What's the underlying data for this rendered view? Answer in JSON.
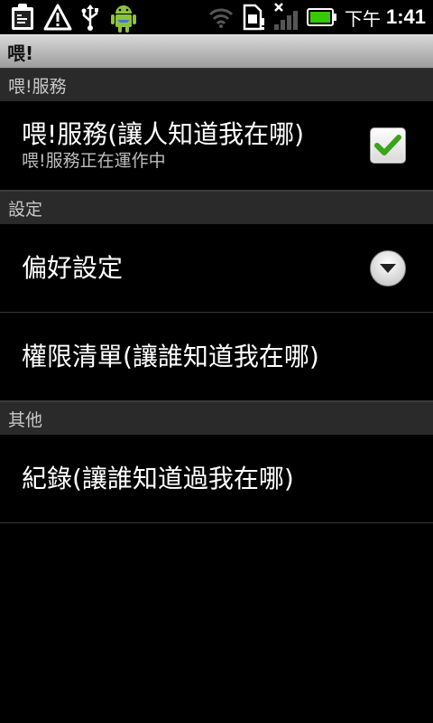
{
  "status_bar": {
    "time": "1:41",
    "ampm": "下午",
    "icons": [
      "clipboard-icon",
      "warning-icon",
      "usb-icon",
      "android-icon",
      "wifi-icon",
      "sim-card-icon",
      "signal-icon",
      "battery-icon"
    ]
  },
  "app": {
    "title": "喂!"
  },
  "sections": {
    "service": {
      "header": "喂!服務",
      "title": "喂!服務(讓人知道我在哪)",
      "summary": "喂!服務正在運作中",
      "checked": true
    },
    "settings": {
      "header": "設定",
      "preferences_title": "偏好設定",
      "permissions_title": "權限清單(讓誰知道我在哪)"
    },
    "other": {
      "header": "其他",
      "log_title": "紀錄(讓誰知道過我在哪)"
    }
  },
  "colors": {
    "background": "#000000",
    "category_bg": "#2a2a2a",
    "titlebar_bg": "#bdbdbd",
    "check_green": "#3aa31a",
    "battery_green": "#33cc00"
  }
}
